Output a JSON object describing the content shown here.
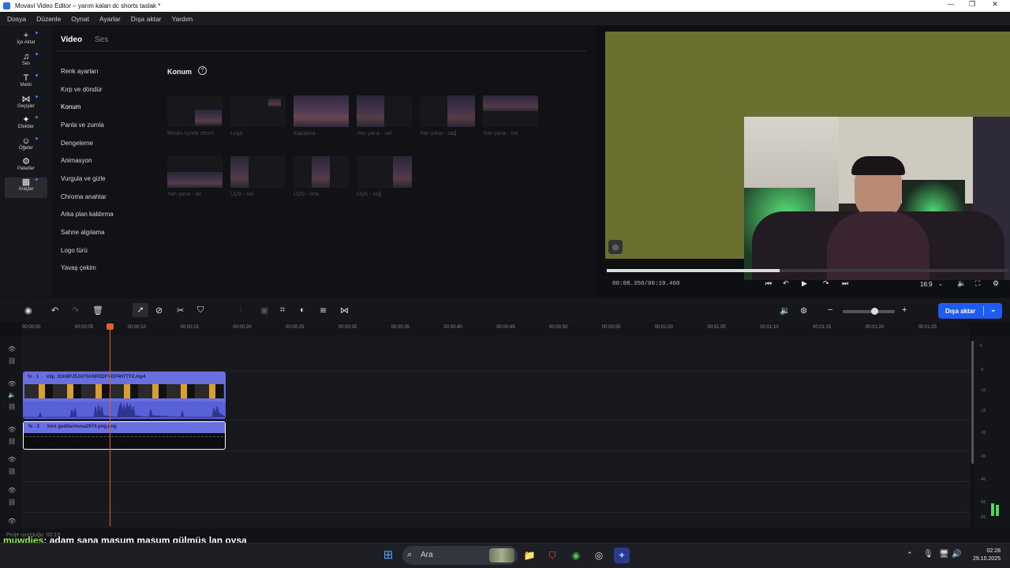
{
  "window": {
    "title": "Movavi Video Editor – yarım kalan dc shorts taslak *"
  },
  "menu": [
    "Dosya",
    "Düzenle",
    "Oynat",
    "Ayarlar",
    "Dışa aktar",
    "Yardım"
  ],
  "sidebar": [
    {
      "label": "İçe Aktar",
      "icon": "+"
    },
    {
      "label": "Ses",
      "icon": "♫"
    },
    {
      "label": "Metin",
      "icon": "T"
    },
    {
      "label": "Geçişler",
      "icon": "⋈"
    },
    {
      "label": "Efektler",
      "icon": "✦"
    },
    {
      "label": "Öğeler",
      "icon": "☺"
    },
    {
      "label": "Paketler",
      "icon": "⚙"
    },
    {
      "label": "Araçlar",
      "icon": "▦"
    }
  ],
  "tabs": {
    "video": "Video",
    "audio": "Ses"
  },
  "submenu": [
    "Renk ayarları",
    "Kırp ve döndür",
    "Konum",
    "Panla ve zumla",
    "Dengeleme",
    "Animasyon",
    "Vurgula ve gizle",
    "Chroma anahtar",
    "Arka plan kaldırma",
    "Sahne algılama",
    "Logo türü",
    "Yavaş çekim"
  ],
  "section": {
    "title": "Konum",
    "help": "?"
  },
  "presets": [
    "Resim içinde resim",
    "Logo",
    "Kaplama",
    "Yan yana - sol",
    "Yan yana - sağ",
    "Yan yana - üst",
    "Yan yana - alt",
    "Üçlü - sol",
    "Üçlü - orta",
    "Üçlü - sağ"
  ],
  "player": {
    "timecode": "00:08.350/00:19.460",
    "ratio": "16:9",
    "progress": 0.43
  },
  "toolbar": {
    "export": "Dışa aktar"
  },
  "ruler": [
    "00:00:00",
    "00:00:05",
    "00:00:10",
    "00:00:15",
    "00:00:20",
    "00:00:25",
    "00:00:30",
    "00:00:35",
    "00:00:40",
    "00:00:45",
    "00:00:50",
    "00:00:55",
    "00:01:00",
    "00:01:05",
    "00:01:10",
    "00:01:15",
    "00:01:20",
    "00:01:25"
  ],
  "clips": {
    "clip1": {
      "badge": "fx · 1",
      "name": "clip_01K8PJ5JAY0ANPZDFYEP4H77TX.mp4"
    },
    "clip2": {
      "badge": "fx · 2",
      "name": "kick gaddarmusa2074 png.png"
    }
  },
  "vu_labels": [
    "0",
    "-5",
    "-10",
    "-15",
    "-20",
    "-30",
    "-40",
    "-50",
    "-60"
  ],
  "status": {
    "duration": "Proje uzunluğu: 00:19"
  },
  "chat": {
    "user": "muwdies",
    "message": ": adam sana masum masum gülmüş lan oysa"
  },
  "taskbar": {
    "search": "Ara",
    "time": "02:28",
    "date": "29.10.2025"
  }
}
